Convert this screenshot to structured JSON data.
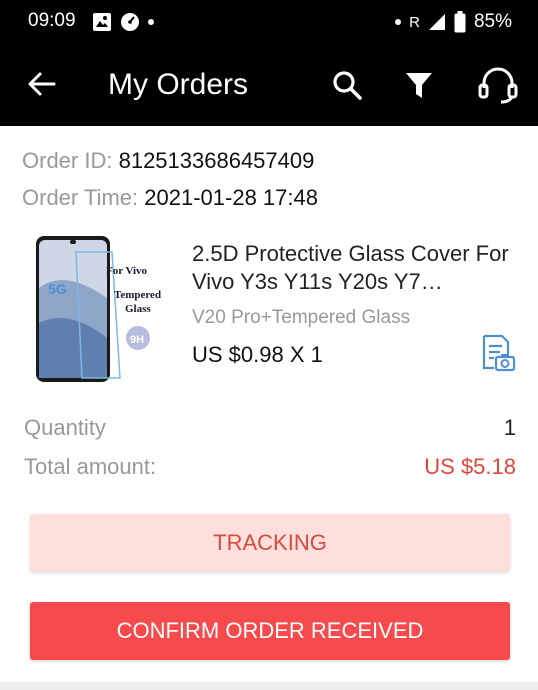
{
  "status_bar": {
    "time": "09:09",
    "signal_letter": "R",
    "battery": "85%"
  },
  "app_bar": {
    "title": "My Orders",
    "icons": [
      "back-arrow-icon",
      "search-icon",
      "filter-icon",
      "customer-support-icon"
    ]
  },
  "order": {
    "id_label": "Order ID:",
    "id_value": "8125133686457409",
    "time_label": "Order Time:",
    "time_value": "2021-01-28 17:48"
  },
  "product": {
    "title": "2.5D Protective Glass Cover For Vivo Y3s Y11s Y20s Y7…",
    "variant": "V20 Pro+Tempered Glass",
    "price": "US $0.98 X 1",
    "image_text": {
      "line1": "For Vivo",
      "line2": "Tempered",
      "line3": "Glass",
      "badge": "9H",
      "phone_label": "5G"
    }
  },
  "summary": {
    "quantity_label": "Quantity",
    "quantity_value": "1",
    "total_label": "Total amount:",
    "total_value": "US $5.18"
  },
  "actions": {
    "tracking": "TRACKING",
    "confirm": "CONFIRM ORDER RECEIVED"
  },
  "colors": {
    "accent_red": "#f74a4d",
    "price_red": "#e0463f",
    "tracking_bg": "#fde0dc",
    "icon_blue": "#4f8fd0"
  }
}
